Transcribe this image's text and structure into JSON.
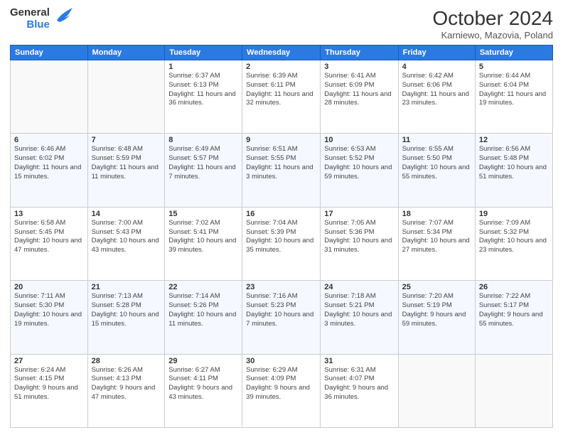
{
  "header": {
    "logo_general": "General",
    "logo_blue": "Blue",
    "month": "October 2024",
    "location": "Karniewo, Mazovia, Poland"
  },
  "days_of_week": [
    "Sunday",
    "Monday",
    "Tuesday",
    "Wednesday",
    "Thursday",
    "Friday",
    "Saturday"
  ],
  "weeks": [
    [
      {
        "day": "",
        "info": ""
      },
      {
        "day": "",
        "info": ""
      },
      {
        "day": "1",
        "info": "Sunrise: 6:37 AM\nSunset: 6:13 PM\nDaylight: 11 hours and 36 minutes."
      },
      {
        "day": "2",
        "info": "Sunrise: 6:39 AM\nSunset: 6:11 PM\nDaylight: 11 hours and 32 minutes."
      },
      {
        "day": "3",
        "info": "Sunrise: 6:41 AM\nSunset: 6:09 PM\nDaylight: 11 hours and 28 minutes."
      },
      {
        "day": "4",
        "info": "Sunrise: 6:42 AM\nSunset: 6:06 PM\nDaylight: 11 hours and 23 minutes."
      },
      {
        "day": "5",
        "info": "Sunrise: 6:44 AM\nSunset: 6:04 PM\nDaylight: 11 hours and 19 minutes."
      }
    ],
    [
      {
        "day": "6",
        "info": "Sunrise: 6:46 AM\nSunset: 6:02 PM\nDaylight: 11 hours and 15 minutes."
      },
      {
        "day": "7",
        "info": "Sunrise: 6:48 AM\nSunset: 5:59 PM\nDaylight: 11 hours and 11 minutes."
      },
      {
        "day": "8",
        "info": "Sunrise: 6:49 AM\nSunset: 5:57 PM\nDaylight: 11 hours and 7 minutes."
      },
      {
        "day": "9",
        "info": "Sunrise: 6:51 AM\nSunset: 5:55 PM\nDaylight: 11 hours and 3 minutes."
      },
      {
        "day": "10",
        "info": "Sunrise: 6:53 AM\nSunset: 5:52 PM\nDaylight: 10 hours and 59 minutes."
      },
      {
        "day": "11",
        "info": "Sunrise: 6:55 AM\nSunset: 5:50 PM\nDaylight: 10 hours and 55 minutes."
      },
      {
        "day": "12",
        "info": "Sunrise: 6:56 AM\nSunset: 5:48 PM\nDaylight: 10 hours and 51 minutes."
      }
    ],
    [
      {
        "day": "13",
        "info": "Sunrise: 6:58 AM\nSunset: 5:45 PM\nDaylight: 10 hours and 47 minutes."
      },
      {
        "day": "14",
        "info": "Sunrise: 7:00 AM\nSunset: 5:43 PM\nDaylight: 10 hours and 43 minutes."
      },
      {
        "day": "15",
        "info": "Sunrise: 7:02 AM\nSunset: 5:41 PM\nDaylight: 10 hours and 39 minutes."
      },
      {
        "day": "16",
        "info": "Sunrise: 7:04 AM\nSunset: 5:39 PM\nDaylight: 10 hours and 35 minutes."
      },
      {
        "day": "17",
        "info": "Sunrise: 7:05 AM\nSunset: 5:36 PM\nDaylight: 10 hours and 31 minutes."
      },
      {
        "day": "18",
        "info": "Sunrise: 7:07 AM\nSunset: 5:34 PM\nDaylight: 10 hours and 27 minutes."
      },
      {
        "day": "19",
        "info": "Sunrise: 7:09 AM\nSunset: 5:32 PM\nDaylight: 10 hours and 23 minutes."
      }
    ],
    [
      {
        "day": "20",
        "info": "Sunrise: 7:11 AM\nSunset: 5:30 PM\nDaylight: 10 hours and 19 minutes."
      },
      {
        "day": "21",
        "info": "Sunrise: 7:13 AM\nSunset: 5:28 PM\nDaylight: 10 hours and 15 minutes."
      },
      {
        "day": "22",
        "info": "Sunrise: 7:14 AM\nSunset: 5:26 PM\nDaylight: 10 hours and 11 minutes."
      },
      {
        "day": "23",
        "info": "Sunrise: 7:16 AM\nSunset: 5:23 PM\nDaylight: 10 hours and 7 minutes."
      },
      {
        "day": "24",
        "info": "Sunrise: 7:18 AM\nSunset: 5:21 PM\nDaylight: 10 hours and 3 minutes."
      },
      {
        "day": "25",
        "info": "Sunrise: 7:20 AM\nSunset: 5:19 PM\nDaylight: 9 hours and 59 minutes."
      },
      {
        "day": "26",
        "info": "Sunrise: 7:22 AM\nSunset: 5:17 PM\nDaylight: 9 hours and 55 minutes."
      }
    ],
    [
      {
        "day": "27",
        "info": "Sunrise: 6:24 AM\nSunset: 4:15 PM\nDaylight: 9 hours and 51 minutes."
      },
      {
        "day": "28",
        "info": "Sunrise: 6:26 AM\nSunset: 4:13 PM\nDaylight: 9 hours and 47 minutes."
      },
      {
        "day": "29",
        "info": "Sunrise: 6:27 AM\nSunset: 4:11 PM\nDaylight: 9 hours and 43 minutes."
      },
      {
        "day": "30",
        "info": "Sunrise: 6:29 AM\nSunset: 4:09 PM\nDaylight: 9 hours and 39 minutes."
      },
      {
        "day": "31",
        "info": "Sunrise: 6:31 AM\nSunset: 4:07 PM\nDaylight: 9 hours and 36 minutes."
      },
      {
        "day": "",
        "info": ""
      },
      {
        "day": "",
        "info": ""
      }
    ]
  ]
}
